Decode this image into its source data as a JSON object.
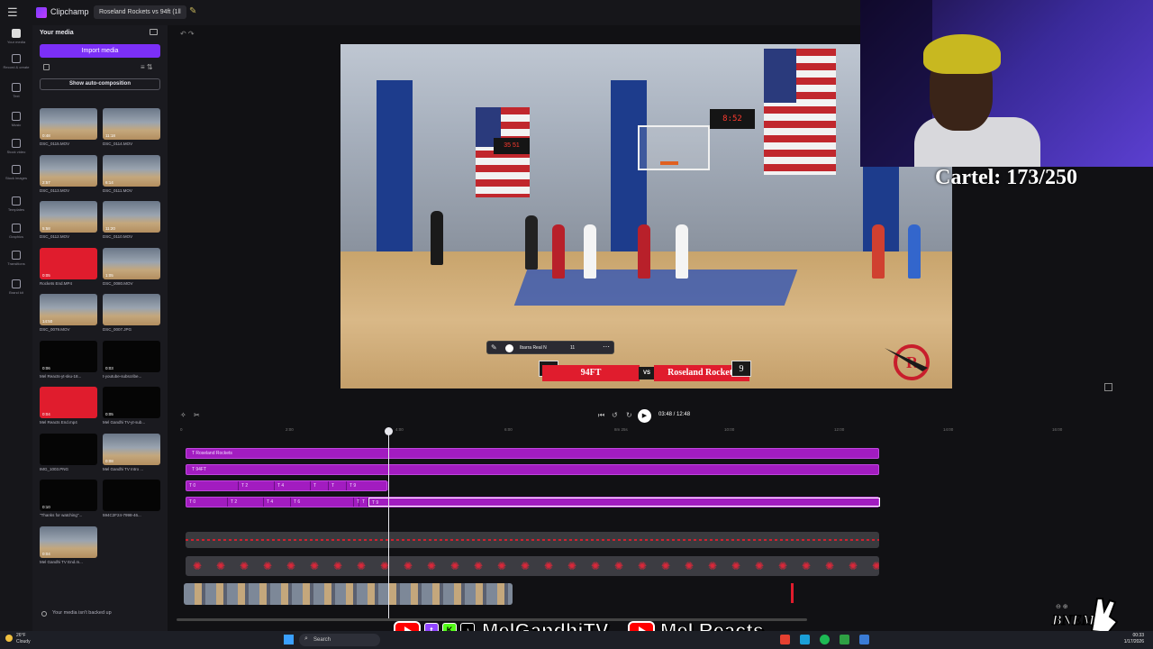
{
  "app": {
    "name": "Clipchamp",
    "project": "Roseland Rockets vs 94ft (1ll"
  },
  "rail": [
    {
      "label": "Your media"
    },
    {
      "label": "Record & create"
    },
    {
      "label": "Text"
    },
    {
      "label": "Music"
    },
    {
      "label": "Stock video"
    },
    {
      "label": "Stock images"
    },
    {
      "label": "Templates"
    },
    {
      "label": "Graphics"
    },
    {
      "label": "Transitions"
    },
    {
      "label": "Brand kit"
    }
  ],
  "media": {
    "header": "Your media",
    "import_label": "Import media",
    "auto_comp_label": "Show auto-composition",
    "items": [
      {
        "name": "DSC_0115.MOV",
        "dur": "0:48",
        "style": "gym"
      },
      {
        "name": "DSC_0114.MOV",
        "dur": "11:18",
        "style": "gym"
      },
      {
        "name": "DSC_0113.MOV",
        "dur": "2:57",
        "style": "gym"
      },
      {
        "name": "DSC_0111.MOV",
        "dur": "6:14",
        "style": "gym"
      },
      {
        "name": "DSC_0112.MOV",
        "dur": "5:58",
        "style": "gym"
      },
      {
        "name": "DSC_0110.MOV",
        "dur": "11:20",
        "style": "gym"
      },
      {
        "name": "Rockets End.MP4",
        "dur": "0:05",
        "style": "red"
      },
      {
        "name": "DSC_0080.MOV",
        "dur": "1:05",
        "style": "gym"
      },
      {
        "name": "DSC_0079.MOV",
        "dur": "14:50",
        "style": "gym"
      },
      {
        "name": "DSC_0007.JPG",
        "dur": "",
        "style": "gym"
      },
      {
        "name": "Mel Reacts-yt-sku-18...",
        "dur": "0:06",
        "style": "dark"
      },
      {
        "name": "t-youtube-subscribe...",
        "dur": "0:03",
        "style": "dark"
      },
      {
        "name": "Mel Reacts End.mp4",
        "dur": "0:04",
        "style": "red"
      },
      {
        "name": "Mel Gandhi TV-yt-sub...",
        "dur": "0:05",
        "style": "dark"
      },
      {
        "name": "IMG_1003.PNG",
        "dur": "",
        "style": "dark"
      },
      {
        "name": "Mel Gandhi TV Intro ...",
        "dur": "0:08",
        "style": "gym"
      },
      {
        "name": "\"Thanks for watching\"...",
        "dur": "0:10",
        "style": "dark"
      },
      {
        "name": "594C2F24-7998-46...",
        "dur": "",
        "style": "dark"
      },
      {
        "name": "Mel Gandhi TV End.m...",
        "dur": "0:04",
        "style": "gym"
      }
    ],
    "backup": "Your media isn't backed up"
  },
  "text_toolbar": {
    "font": "Ibarra Real N",
    "size": "11"
  },
  "scorebar": {
    "left_score": "10",
    "left_team": "94FT",
    "vs": "VS",
    "right_team": "Roseland Rockets",
    "right_score": "9"
  },
  "video_scoreboard": "8:52",
  "video_scoreboard2": "35 51",
  "overlay": {
    "cartel": "Cartel: 173/250"
  },
  "playback": {
    "timecode": "03:48 / 12:48"
  },
  "ruler": [
    "0",
    "2:00",
    "4:00",
    "6:00",
    "8m 25s",
    "10:00",
    "12:00",
    "14:00",
    "16:00"
  ],
  "tracks": {
    "t1": "Roseland Rockets",
    "t2": "94FT",
    "t3": [
      "0",
      "2",
      "4",
      "",
      "",
      "9"
    ],
    "t4": [
      "0",
      "2",
      "4",
      "6",
      "",
      "",
      "9"
    ]
  },
  "social": {
    "channel1": "MelGandhiTV",
    "channel2": "Mel Reacts",
    "brand": "BNEM"
  },
  "taskbar": {
    "temp": "26°F",
    "weather": "Cloudy",
    "search": "Search",
    "time": "00:33",
    "date": "1/17/2026"
  }
}
